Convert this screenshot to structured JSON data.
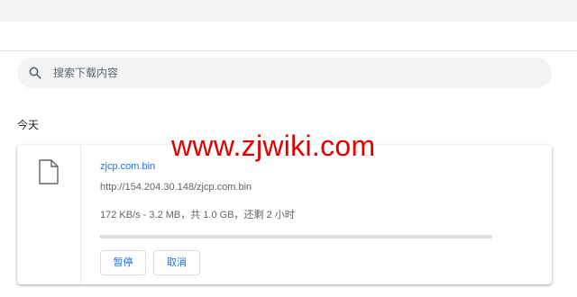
{
  "search": {
    "placeholder": "搜索下载内容",
    "icon": "search-icon"
  },
  "section": {
    "label": "今天"
  },
  "download": {
    "file_name": "zjcp.com.bin",
    "url": "http://154.204.30.148/zjcp.com.bin",
    "status": "172 KB/s - 3.2 MB，共 1.0 GB，还剩 2 小时",
    "progress_fraction": 0.003,
    "icon": "file-icon",
    "buttons": {
      "pause": "暂停",
      "cancel": "取消"
    }
  },
  "watermark": {
    "text": "www.zjwiki.com",
    "color": "#e00000"
  },
  "colors": {
    "accent": "#1a73e8",
    "secondary_text": "#5f6368",
    "search_background": "#f1f3f4"
  }
}
